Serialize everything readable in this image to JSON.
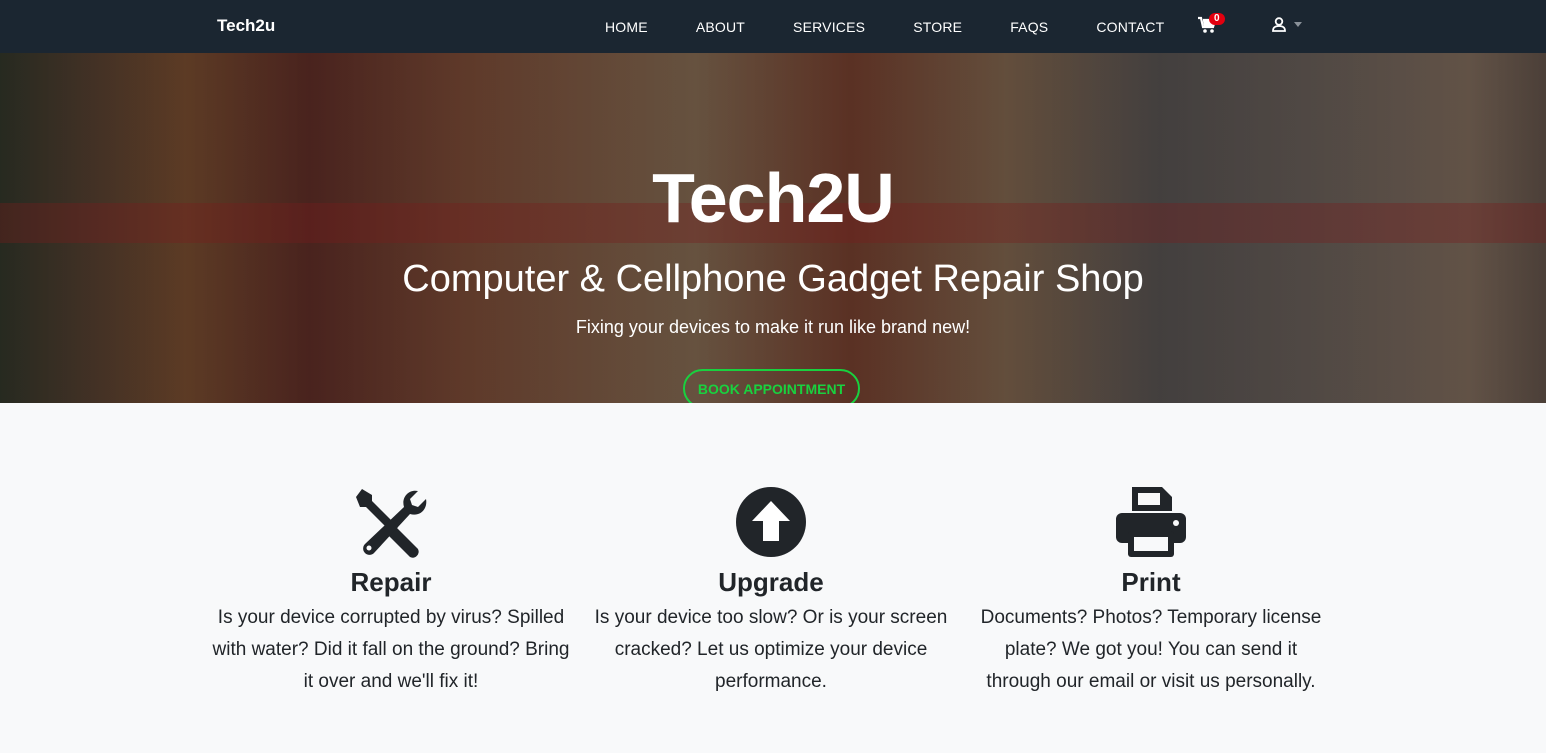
{
  "nav": {
    "brand": "Tech2u",
    "links": [
      "HOME",
      "ABOUT",
      "SERVICES",
      "STORE",
      "FAQS",
      "CONTACT"
    ],
    "cart_count": "0"
  },
  "hero": {
    "title": "Tech2U",
    "subtitle": "Computer & Cellphone Gadget Repair Shop",
    "tagline": "Fixing your devices to make it run like brand new!",
    "cta": "BOOK APPOINTMENT"
  },
  "features": [
    {
      "title": "Repair",
      "text": "Is your device corrupted by virus? Spilled with water? Did it fall on the ground? Bring it over and we'll fix it!"
    },
    {
      "title": "Upgrade",
      "text": "Is your device too slow? Or is your screen cracked? Let us optimize your device performance."
    },
    {
      "title": "Print",
      "text": "Documents? Photos? Temporary license plate? We got you! You can send it through our email or visit us personally."
    }
  ],
  "colors": {
    "nav": "#1b2631",
    "accent": "#19d13f",
    "badge": "#e3000f"
  }
}
